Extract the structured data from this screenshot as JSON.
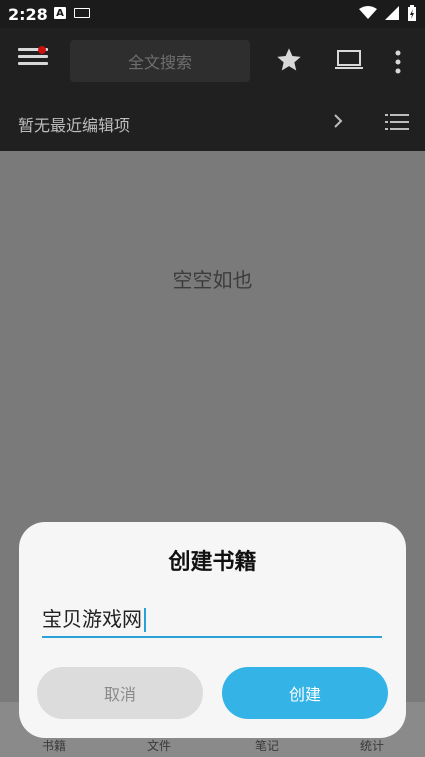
{
  "status_bar": {
    "time": "2:28"
  },
  "header": {
    "search_placeholder": "全文搜索"
  },
  "recent": {
    "text": "暂无最近编辑项"
  },
  "main": {
    "empty_text": "空空如也"
  },
  "bottom_nav": {
    "items": [
      {
        "label": "书籍"
      },
      {
        "label": "文件"
      },
      {
        "label": "笔记"
      },
      {
        "label": "统计"
      }
    ]
  },
  "dialog": {
    "title": "创建书籍",
    "input_value": "宝贝游戏网",
    "cancel_label": "取消",
    "create_label": "创建"
  },
  "colors": {
    "accent": "#34b4e6",
    "dark_bar": "#202020",
    "notification_dot": "#cc1111"
  },
  "icons": {
    "menu": "menu-icon",
    "star": "star-icon",
    "laptop": "laptop-icon",
    "kebab": "more-vert-icon",
    "chevron": "chevron-right-icon",
    "list": "list-icon"
  }
}
